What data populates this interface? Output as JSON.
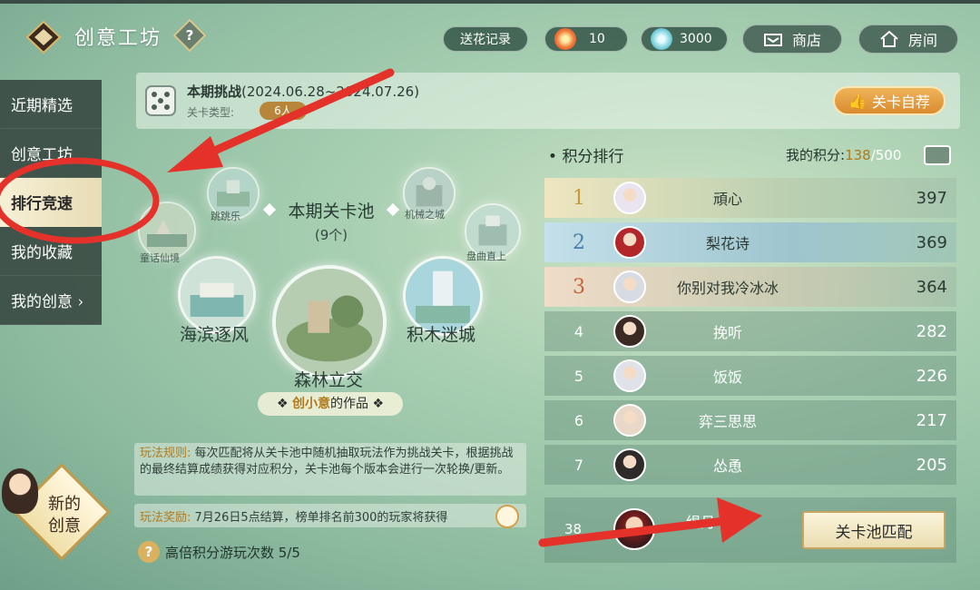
{
  "header": {
    "title": "创意工坊",
    "help_symbol": "?",
    "flower_log_label": "送花记录",
    "flower_count": "10",
    "jade_count": "3000",
    "shop_label": "商店",
    "room_label": "房间"
  },
  "sidebar": {
    "items": [
      {
        "label": "近期精选"
      },
      {
        "label": "创意工坊"
      },
      {
        "label": "排行竞速"
      },
      {
        "label": "我的收藏"
      },
      {
        "label": "我的创意 ›"
      }
    ],
    "active": "排行竞速"
  },
  "challenge": {
    "title": "本期挑战",
    "period": "(2024.06.28~2024.07.26)",
    "type_label": "关卡类型:",
    "type_value": "6人",
    "recommend_label": "关卡自荐"
  },
  "pool": {
    "title": "本期关卡池",
    "count": "(9个)",
    "maps": [
      {
        "name": "跳跳乐"
      },
      {
        "name": "机械之城"
      },
      {
        "name": "童话仙境"
      },
      {
        "name": "盘曲直上"
      },
      {
        "name": "海滨逐风"
      },
      {
        "name": "积木迷城"
      },
      {
        "name": "森林立交"
      }
    ],
    "author_name": "创小意",
    "author_suffix": "的作品"
  },
  "rules": {
    "label": "玩法规则:",
    "text": "每次匹配将从关卡池中随机抽取玩法作为挑战关卡，根据挑战的最终结算成绩获得对应积分，关卡池每个版本会进行一次轮换/更新。"
  },
  "reward": {
    "label": "玩法奖励:",
    "text": "7月26日5点结算，榜单排名前300的玩家将获得"
  },
  "bonus": {
    "text": "高倍积分游玩次数 5/5"
  },
  "new_creation": {
    "line1": "新的",
    "line2": "创意"
  },
  "leaderboard": {
    "title": "积分排行",
    "my_score_label": "我的积分:",
    "my_score": "138",
    "my_score_max": "/500",
    "rows": [
      {
        "rank": "1",
        "name": "頑心",
        "score": "397",
        "avatar_color": "#e9e4ef"
      },
      {
        "rank": "2",
        "name": "梨花诗",
        "score": "369",
        "avatar_color": "#b3262a"
      },
      {
        "rank": "3",
        "name": "你别对我冷冰冰",
        "score": "364",
        "avatar_color": "#d7dbe2"
      },
      {
        "rank": "4",
        "name": "挽听",
        "score": "282",
        "avatar_color": "#3b2a24"
      },
      {
        "rank": "5",
        "name": "饭饭",
        "score": "226",
        "avatar_color": "#dfe2e8"
      },
      {
        "rank": "6",
        "name": "弈三思思",
        "score": "217",
        "avatar_color": "#e8d8c8"
      },
      {
        "rank": "7",
        "name": "怂恿",
        "score": "205",
        "avatar_color": "#2e2a2a"
      }
    ],
    "me": {
      "rank": "38",
      "name": "缇月"
    },
    "match_label": "关卡池匹配"
  },
  "colors": {
    "accent_gold": "#b07a1c",
    "annotation_red": "#e4322b"
  }
}
